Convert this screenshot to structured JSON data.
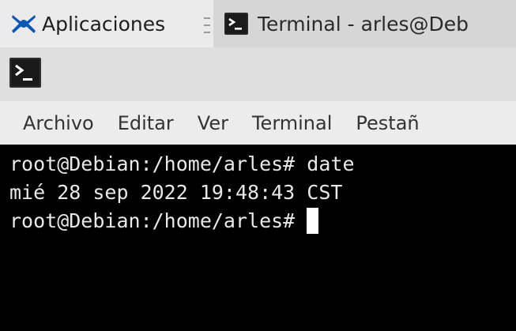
{
  "panel": {
    "apps_menu_label": "Aplicaciones",
    "taskbar_window_label": "Terminal - arles@Deb",
    "icons": {
      "apps_menu": "xfce-mouse-logo-icon",
      "taskbar_window": "terminal-icon"
    }
  },
  "window": {
    "icon": "terminal-icon"
  },
  "menubar": {
    "items": [
      "Archivo",
      "Editar",
      "Ver",
      "Terminal",
      "Pestañ"
    ]
  },
  "terminal": {
    "lines": [
      {
        "prompt": "root@Debian:/home/arles#",
        "command": " date"
      },
      {
        "output": "mié 28 sep 2022 19:48:43 CST"
      },
      {
        "prompt": "root@Debian:/home/arles#",
        "command": ""
      }
    ]
  },
  "colors": {
    "panel_bg": "#ebebeb",
    "taskbutton_bg": "#d6d6d6",
    "titlebar_bg": "#dfdfdf",
    "menubar_bg": "#ececec",
    "terminal_bg": "#000000",
    "terminal_fg": "#e8e8e8",
    "xfce_logo": "#0b57b8"
  }
}
